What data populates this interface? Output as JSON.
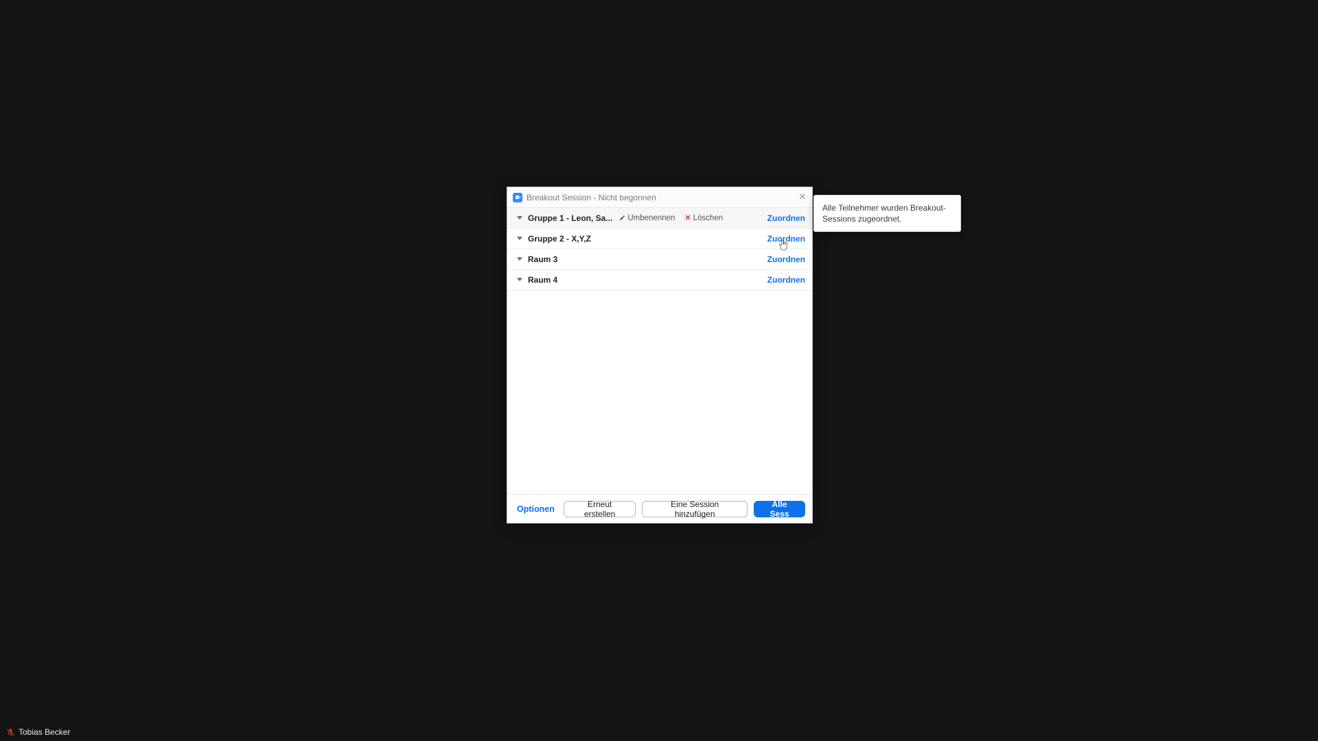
{
  "dialog": {
    "title": "Breakout Session - Nicht begonnen",
    "rooms": [
      {
        "name": "Gruppe 1 - Leon, Sa...",
        "assign": "Zuordnen",
        "rename": "Umbenennen",
        "delete": "Löschen",
        "hover": true
      },
      {
        "name": "Gruppe 2 - X,Y,Z",
        "assign": "Zuordnen"
      },
      {
        "name": "Raum 3",
        "assign": "Zuordnen"
      },
      {
        "name": "Raum 4",
        "assign": "Zuordnen"
      }
    ],
    "footer": {
      "options": "Optionen",
      "recreate": "Erneut erstellen",
      "add_session": "Eine Session hinzufügen",
      "start_all": "Alle Sess"
    }
  },
  "toast": {
    "message": "Alle Teilnehmer wurden Breakout-Sessions zugeordnet."
  },
  "participant": {
    "name": "Tobias Becker"
  }
}
